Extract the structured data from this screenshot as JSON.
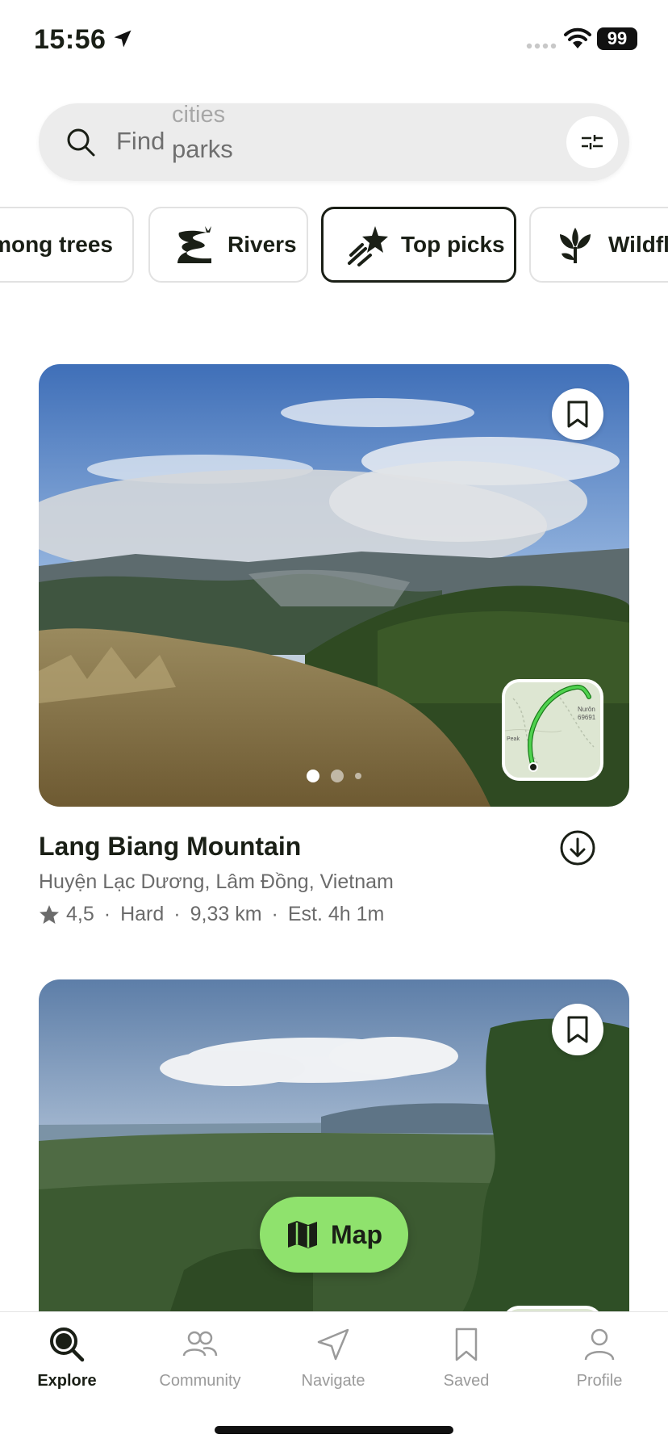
{
  "status_bar": {
    "time": "15:56",
    "battery": "99"
  },
  "search": {
    "prefix": "Find",
    "faded_word": "cities",
    "current_word": "parks"
  },
  "chips": [
    {
      "label": "mong trees",
      "icon": "trees-icon",
      "active": false
    },
    {
      "label": "Rivers",
      "icon": "rivers-icon",
      "active": false
    },
    {
      "label": "Top picks",
      "icon": "shooting-star-icon",
      "active": true
    },
    {
      "label": "Wildflo",
      "icon": "wildflower-icon",
      "active": false
    }
  ],
  "trails": [
    {
      "name": "Lang Biang Mountain",
      "location": "Huyện Lạc Dương, Lâm Đồng, Vietnam",
      "rating": "4,5",
      "difficulty": "Hard",
      "distance": "9,33 km",
      "duration": "Est. 4h 1m",
      "separator": "·",
      "map_labels": [
        "Nurôn",
        "69691",
        "Peak"
      ]
    },
    {
      "name": "",
      "location": ""
    }
  ],
  "map_button": {
    "label": "Map"
  },
  "tab_bar": {
    "tabs": [
      {
        "label": "Explore",
        "active": true
      },
      {
        "label": "Community",
        "active": false
      },
      {
        "label": "Navigate",
        "active": false
      },
      {
        "label": "Saved",
        "active": false
      },
      {
        "label": "Profile",
        "active": false
      }
    ]
  },
  "colors": {
    "accent_green": "#8fe26d",
    "route_green": "#3cc23c",
    "text_dark": "#1a1f16",
    "text_muted": "#6b6b6b"
  }
}
